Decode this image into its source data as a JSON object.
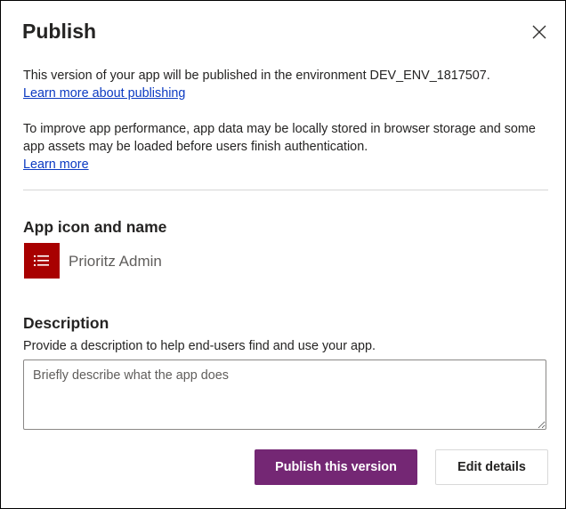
{
  "dialog": {
    "title": "Publish",
    "close_icon": "close-icon"
  },
  "info": {
    "environment_text": "This version of your app will be published in the environment DEV_ENV_1817507.",
    "learn_more_publishing": "Learn more about publishing",
    "performance_text": "To improve app performance, app data may be locally stored in browser storage and some app assets may be loaded before users finish authentication.",
    "learn_more": "Learn more"
  },
  "app": {
    "section_title": "App icon and name",
    "icon": "list-icon",
    "icon_color": "#a80000",
    "name": "Prioritz Admin"
  },
  "description": {
    "section_title": "Description",
    "help_text": "Provide a description to help end-users find and use your app.",
    "value": "",
    "placeholder": "Briefly describe what the app does"
  },
  "actions": {
    "publish_label": "Publish this version",
    "publish_color": "#742774",
    "edit_label": "Edit details"
  }
}
